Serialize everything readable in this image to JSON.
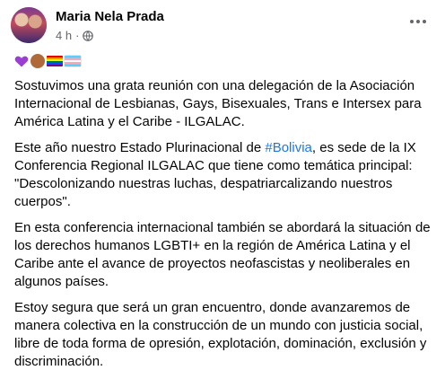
{
  "post": {
    "author": "Maria Nela Prada",
    "time": "4 h",
    "paragraphs": {
      "p1": "Sostuvimos una grata reunión con una delegación de la Asociación\nInternacional de Lesbianas, Gays, Bisexuales, Trans e Intersex para\nAmérica Latina y el Caribe - ILGALAC.",
      "p2_before": "Este año nuestro Estado Plurinacional de ",
      "p2_tag": "#Bolivia",
      "p2_after": ", es sede de la IX\nConferencia Regional ILGALAC que tiene como temática principal:\n\"Descolonizando nuestras luchas, despatriarcalizando nuestros\ncuerpos\".",
      "p3": "En esta conferencia internacional también se abordará la situación de\nlos derechos humanos LGBTI+ en la región de América Latina y el\nCaribe ante el avance de proyectos neofascistas y neoliberales en\nalgunos países.",
      "p4": "Estoy segura que será un gran encuentro, donde avanzaremos de\nmanera colectiva en la construcción de un mundo con justicia social,\nlibre de toda forma de opresión, explotación, dominación, exclusión y\ndiscriminación."
    },
    "emojis": [
      "purple-heart",
      "raised-fist",
      "rainbow-flag",
      "transgender-flag"
    ],
    "colors": {
      "link": "#1877f2",
      "meta": "#65676b",
      "text": "#050505"
    }
  }
}
